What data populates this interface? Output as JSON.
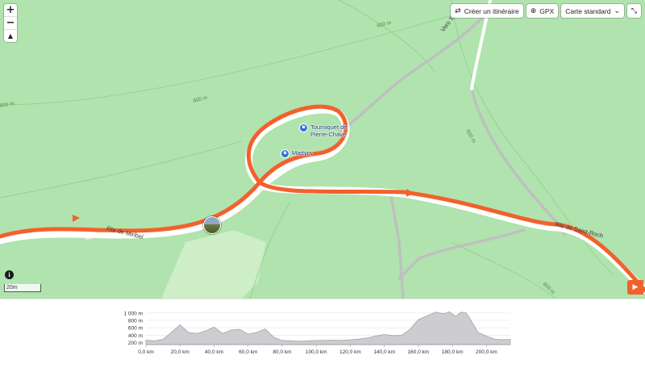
{
  "controls": {
    "zoom_in": "+",
    "zoom_out": "−",
    "compass": "▲",
    "info": "i",
    "play": "▶"
  },
  "toolbar": {
    "create_route_label": "Créer un itinéraire",
    "create_route_icon": "route-icon",
    "gpx_label": "GPX",
    "gpx_icon": "download-icon",
    "map_style_label": "Carte standard",
    "map_style_icon": "chevron-down-icon",
    "collapse_icon": "collapse-icon"
  },
  "map": {
    "scale_label": "20m",
    "road_labels": [
      "Rte de Miribel",
      "Rte de Saint-Roch",
      "Vers Tournin"
    ],
    "contour_labels": [
      "600 m",
      "600 m",
      "600 m",
      "600 m",
      "600 m"
    ],
    "pois": [
      {
        "name": "Tourniquet de\nPierre-Chave",
        "icon": "camera-icon"
      },
      {
        "name": "Martyrs",
        "icon": "camera-icon"
      }
    ],
    "colors": {
      "route": "#f2612d",
      "land": "#b0e3ad",
      "road": "#ffffff"
    }
  },
  "elevation_profile": {
    "y_ticks": [
      "1 000 m",
      "800 m",
      "600 m",
      "400 m",
      "200 m"
    ],
    "x_ticks": [
      "0,0 km",
      "20,0 km",
      "40,0 km",
      "60,0 km",
      "80,0 km",
      "100,0 km",
      "120,0 km",
      "140,0 km",
      "160,0 km",
      "180,0 km",
      "200,0 km"
    ],
    "chart_data": {
      "type": "area",
      "xlabel": "",
      "ylabel": "",
      "xlim": [
        0,
        214
      ],
      "ylim": [
        150,
        1060
      ],
      "x": [
        0,
        5,
        10,
        15,
        20,
        25,
        30,
        35,
        40,
        45,
        50,
        55,
        60,
        65,
        70,
        75,
        80,
        85,
        90,
        95,
        100,
        105,
        110,
        115,
        120,
        125,
        130,
        135,
        140,
        145,
        150,
        155,
        160,
        165,
        170,
        175,
        178,
        182,
        185,
        188,
        190,
        195,
        200,
        205,
        210,
        214
      ],
      "y": [
        270,
        250,
        290,
        480,
        680,
        480,
        450,
        520,
        620,
        450,
        540,
        560,
        430,
        480,
        570,
        350,
        260,
        250,
        240,
        250,
        260,
        260,
        270,
        260,
        280,
        300,
        330,
        380,
        420,
        390,
        400,
        560,
        820,
        920,
        1020,
        980,
        1030,
        910,
        1020,
        1000,
        870,
        480,
        380,
        290,
        280,
        290
      ],
      "colors": {
        "fill": "#cdcdd1",
        "stroke": "#9b9ba3",
        "grid": "#e4e4e4"
      }
    }
  }
}
